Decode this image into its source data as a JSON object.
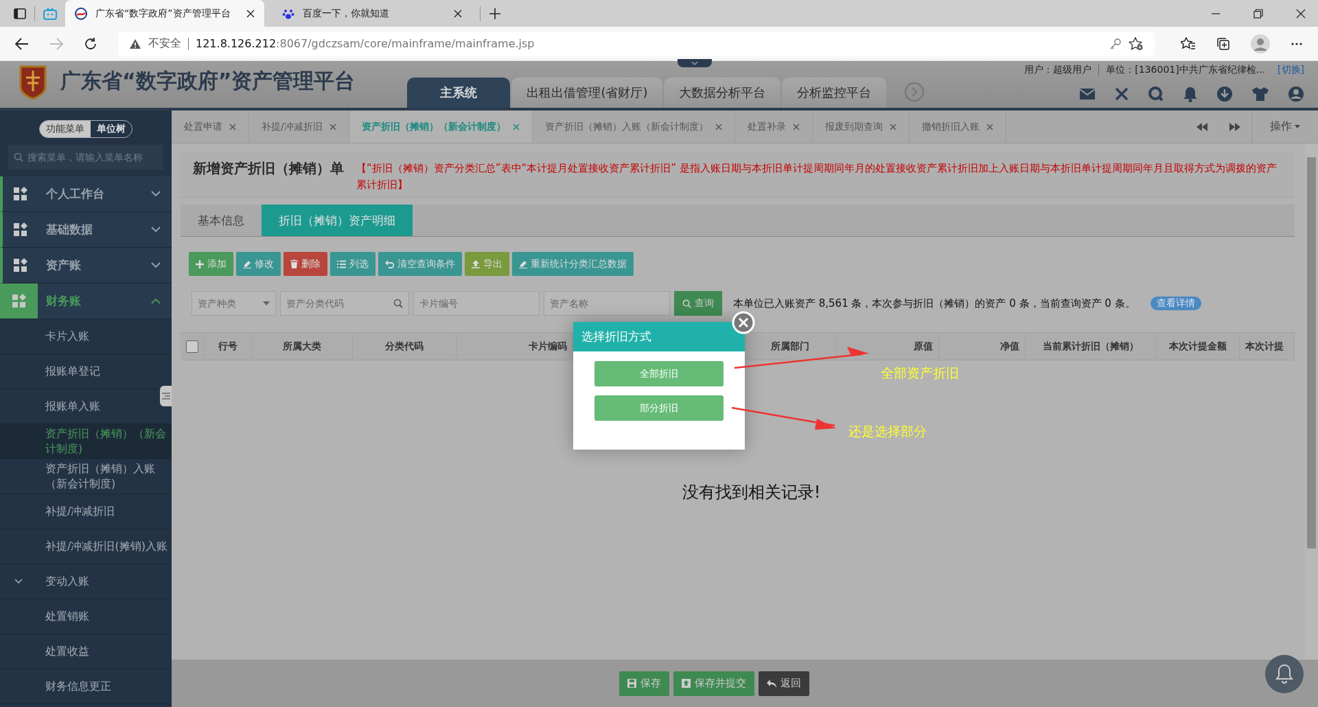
{
  "browser": {
    "tabs": [
      {
        "title": "广东省“数字政府”资产管理平台",
        "selected": true
      },
      {
        "title": "百度一下，你就知道",
        "selected": false
      }
    ],
    "security": "不安全",
    "url_host": "121.8.126.212",
    "url_rest": ":8067/gdczsam/core/mainframe/mainframe.jsp"
  },
  "header": {
    "title": "广东省“数字政府”资产管理平台",
    "nav": [
      {
        "label": "主系统",
        "selected": true
      },
      {
        "label": "出租出借管理(省财厅)",
        "selected": false
      },
      {
        "label": "大数据分析平台",
        "selected": false
      },
      {
        "label": "分析监控平台",
        "selected": false
      }
    ],
    "user": "用户：超级用户",
    "unit": "单位：[136001]中共广东省纪律检...",
    "switch": "[切换]"
  },
  "sidebar": {
    "toggle": [
      {
        "label": "功能菜单",
        "selected": true
      },
      {
        "label": "单位树",
        "selected": false
      }
    ],
    "search_placeholder": "搜索菜单，请输入菜单名称",
    "menu": [
      {
        "label": "个人工作台",
        "expanded": false,
        "selected": false
      },
      {
        "label": "基础数据",
        "expanded": false,
        "selected": false
      },
      {
        "label": "资产账",
        "expanded": false,
        "selected": false
      },
      {
        "label": "财务账",
        "expanded": true,
        "selected": true,
        "children": [
          {
            "label": "卡片入账",
            "selected": false
          },
          {
            "label": "报账单登记",
            "selected": false
          },
          {
            "label": "报账单入账",
            "selected": false
          },
          {
            "label": "资产折旧（摊销）（新会计制度)",
            "selected": true
          },
          {
            "label": "资产折旧（摊销）入账（新会计制度)",
            "selected": false
          },
          {
            "label": "补提/冲减折旧",
            "selected": false
          },
          {
            "label": "补提/冲减折旧(摊销)入账",
            "selected": false
          },
          {
            "label": "变动入账",
            "selected": false,
            "expanded": false
          },
          {
            "label": "处置销账",
            "selected": false
          },
          {
            "label": "处置收益",
            "selected": false
          },
          {
            "label": "财务信息更正",
            "selected": false
          }
        ]
      }
    ]
  },
  "tabs": [
    {
      "label": "处置申请",
      "selected": false
    },
    {
      "label": "补提/冲减折旧",
      "selected": false
    },
    {
      "label": "资产折旧（摊销）（新会计制度）",
      "selected": true
    },
    {
      "label": "资产折旧（摊销）入账（新会计制度）",
      "selected": false
    },
    {
      "label": "处置补录",
      "selected": false
    },
    {
      "label": "报废到期查询",
      "selected": false
    },
    {
      "label": "撤销折旧入账",
      "selected": false
    }
  ],
  "operations": "操作",
  "form": {
    "title": "新增资产折旧（摊销）单",
    "notice": "【“折旧（摊销）资产分类汇总”表中“本计提月处置接收资产累计折旧” 是指入账日期与本折旧单计提周期同年月的处置接收资产累计折旧加上入账日期与本折旧单计提周期同年月且取得方式为调拨的资产累计折旧】",
    "subtabs": [
      {
        "label": "基本信息",
        "selected": false
      },
      {
        "label": "折旧（摊销）资产明细",
        "selected": true
      }
    ],
    "toolbar": [
      {
        "label": "添加",
        "color": "#4a9a5b"
      },
      {
        "label": "修改",
        "color": "#3a9693"
      },
      {
        "label": "删除",
        "color": "#b8463c"
      },
      {
        "label": "列选",
        "color": "#3a9693"
      },
      {
        "label": "清空查询条件",
        "color": "#3a9693"
      },
      {
        "label": "导出",
        "color": "#7a9a3e"
      },
      {
        "label": "重新统计分类汇总数据",
        "color": "#3a9693"
      }
    ],
    "filters": [
      {
        "placeholder": "资产种类",
        "kind": "select"
      },
      {
        "placeholder": "资产分类代码",
        "kind": "search"
      },
      {
        "placeholder": "卡片编号",
        "kind": "text"
      },
      {
        "placeholder": "资产名称",
        "kind": "text"
      }
    ],
    "query": "查询",
    "summary": "本单位已入账资产 8,561 条，本次参与折旧（摊销）的资产 0 条，当前查询资产 0 条。",
    "details": "查看详情",
    "table": {
      "select_all": false,
      "columns": [
        "行号",
        "所属大类",
        "分类代码",
        "卡片编码",
        "所属部门",
        "原值",
        "净值",
        "当前累计折旧（摊销）",
        "本次计提金额",
        "本次计提"
      ],
      "empty": "没有找到相关记录!"
    },
    "footer": [
      {
        "label": "保存",
        "kind": "primary"
      },
      {
        "label": "保存并提交",
        "kind": "primary"
      },
      {
        "label": "返回",
        "kind": "dark"
      }
    ]
  },
  "dialog": {
    "title": "选择折旧方式",
    "buttons": [
      "全部折旧",
      "部分折旧"
    ]
  },
  "annotations": [
    "全部资产折旧",
    "还是选择部分"
  ]
}
